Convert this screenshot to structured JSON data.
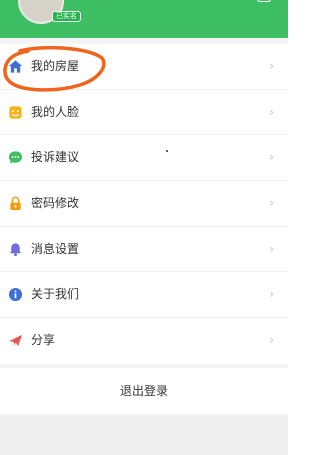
{
  "profile": {
    "verified_badge": "已实名"
  },
  "menu": {
    "items": [
      {
        "label": "我的房屋",
        "icon": "house-icon",
        "chevron": "›"
      },
      {
        "label": "我的人脸",
        "icon": "face-icon",
        "chevron": "›"
      },
      {
        "label": "投诉建议",
        "icon": "chat-bubble-icon",
        "chevron": "›"
      },
      {
        "label": "密码修改",
        "icon": "lock-icon",
        "chevron": "›"
      },
      {
        "label": "消息设置",
        "icon": "bell-icon",
        "chevron": "›"
      },
      {
        "label": "关于我们",
        "icon": "info-icon",
        "chevron": "›"
      },
      {
        "label": "分享",
        "icon": "paper-plane-icon",
        "chevron": "›"
      }
    ]
  },
  "logout": {
    "label": "退出登录"
  },
  "colors": {
    "header_green": "#3fbf63",
    "highlight_orange": "#f0641e"
  }
}
